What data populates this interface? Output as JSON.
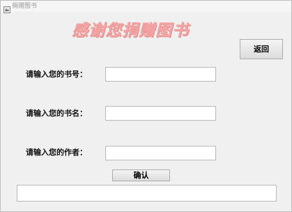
{
  "window": {
    "title": "捐赠图书",
    "icon": "java-app-icon"
  },
  "banner": {
    "text": "感谢您捐赠图书",
    "color": "#f4a4a4"
  },
  "buttons": {
    "back_label": "返回",
    "confirm_label": "确认"
  },
  "form": {
    "book_number": {
      "label": "请输入您的书号：",
      "value": ""
    },
    "book_name": {
      "label": "请输入您的书名：",
      "value": ""
    },
    "author": {
      "label": "请输入您的作者：",
      "value": ""
    }
  },
  "status": {
    "value": ""
  }
}
